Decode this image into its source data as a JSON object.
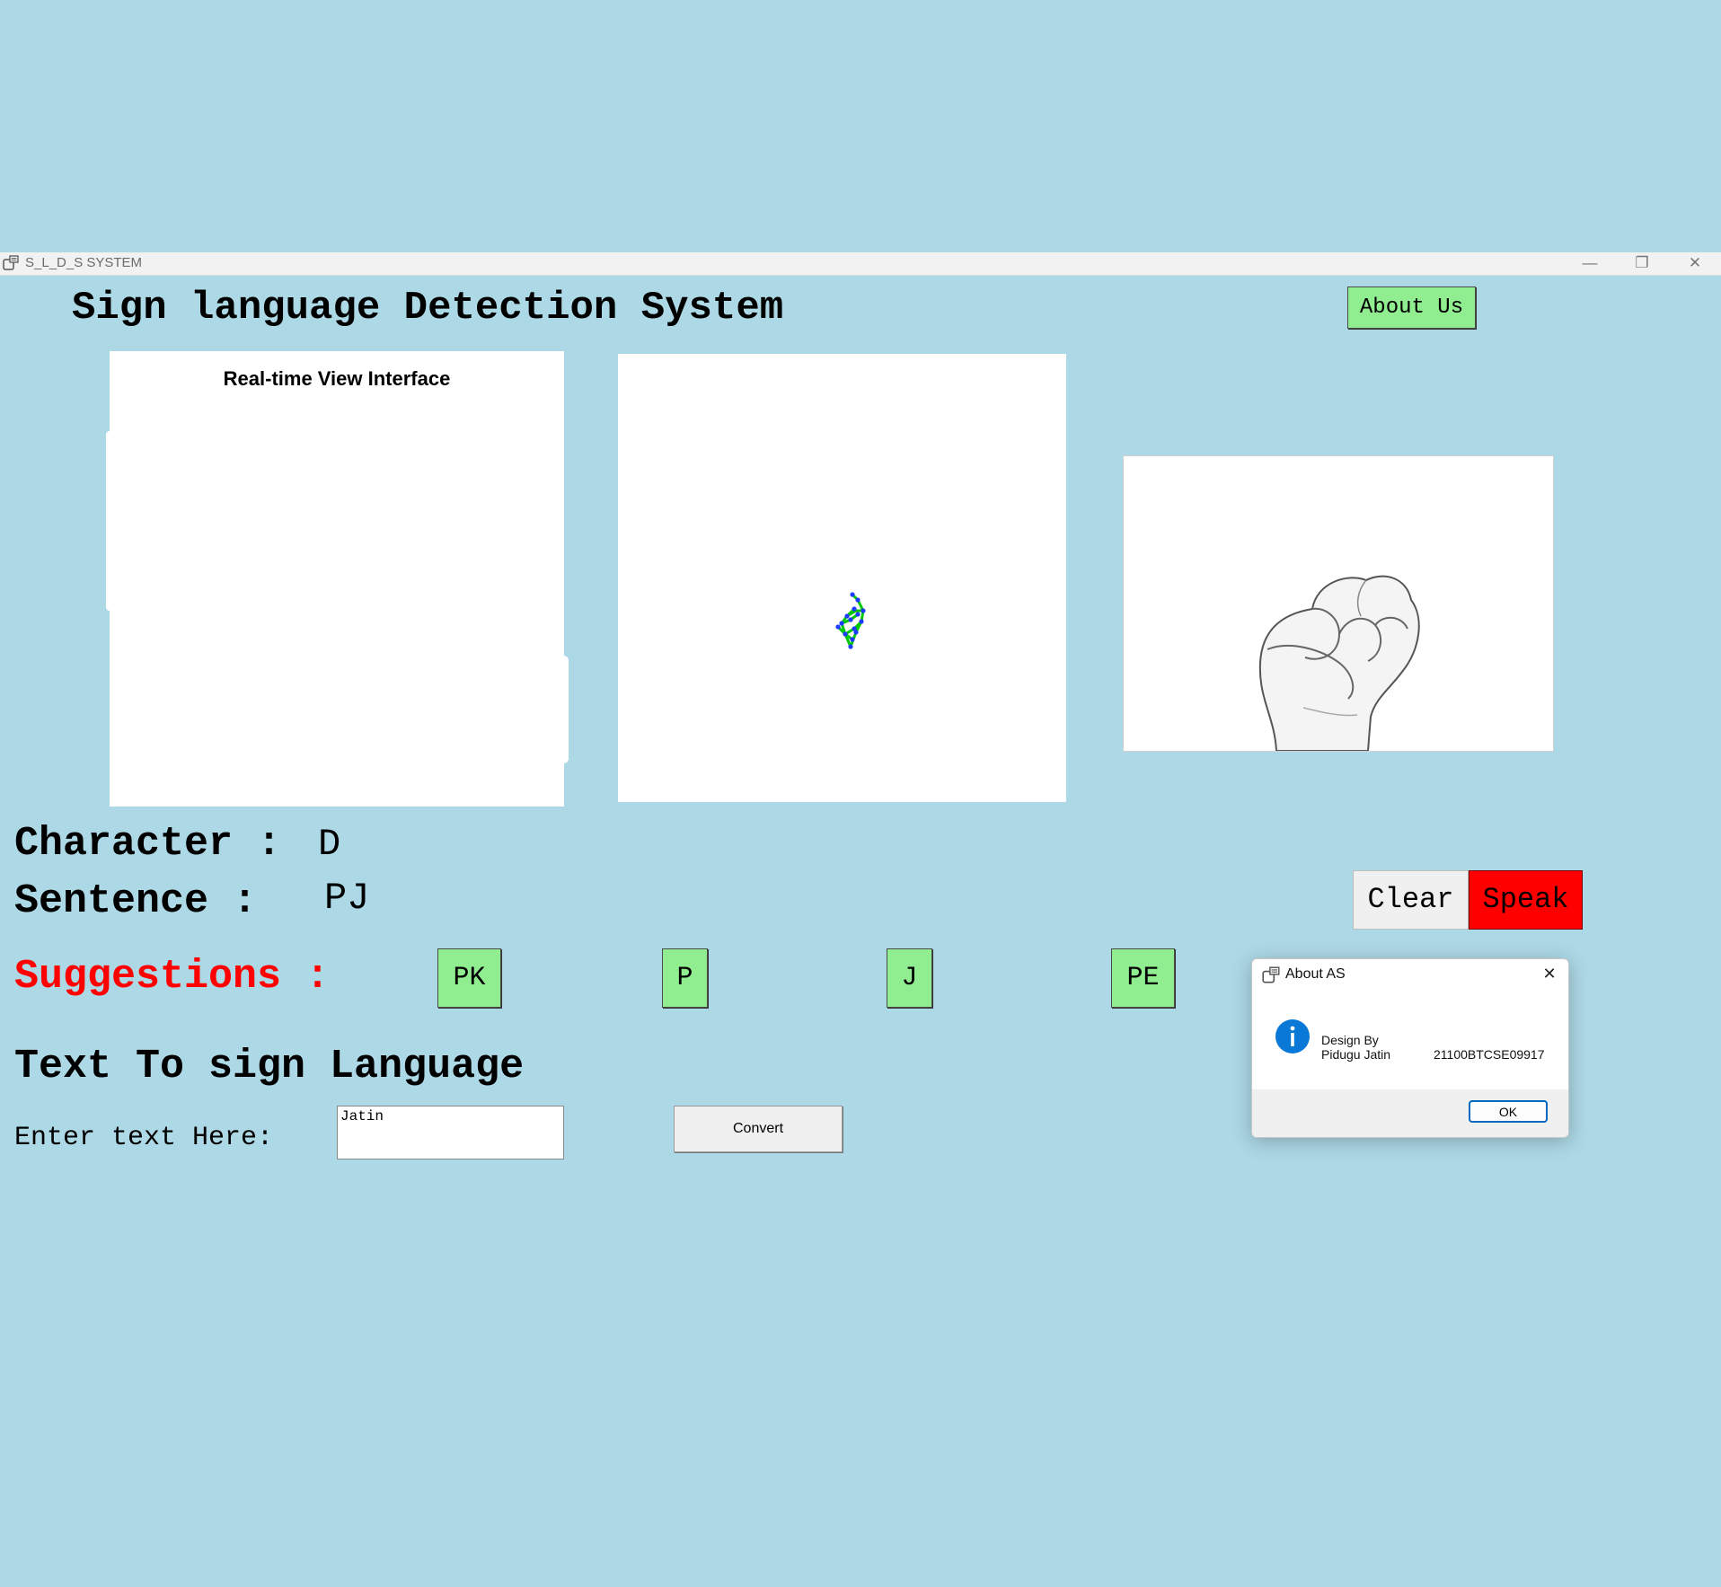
{
  "window": {
    "title": "S_L_D_S SYSTEM",
    "controls": {
      "minimize": "—",
      "maximize": "❐",
      "close": "✕"
    }
  },
  "app": {
    "heading": "Sign language Detection System",
    "about_button": "About Us"
  },
  "panels": {
    "realtime_label": "Real-time View Interface"
  },
  "recognition": {
    "character_label": "Character :",
    "character_value": "D",
    "sentence_label": "Sentence :",
    "sentence_value": "PJ",
    "clear_button": "Clear",
    "speak_button": "Speak"
  },
  "suggestions": {
    "label": "Suggestions :",
    "items": [
      "PK",
      "P",
      "J",
      "PE"
    ]
  },
  "text_to_sign": {
    "heading": "Text To sign Language",
    "input_label": "Enter text Here:",
    "input_value": "Jatin",
    "convert_button": "Convert"
  },
  "dialog": {
    "title": "About AS",
    "line1": "Design By",
    "line2": "Pidugu Jatin",
    "id_text": "21100BTCSE09917",
    "ok_button": "OK"
  },
  "colors": {
    "background": "#add8e6",
    "button_green": "#90ee90",
    "speak_red": "#ff0000",
    "suggestions_red": "#ff0000",
    "info_blue": "#0a78d7"
  }
}
